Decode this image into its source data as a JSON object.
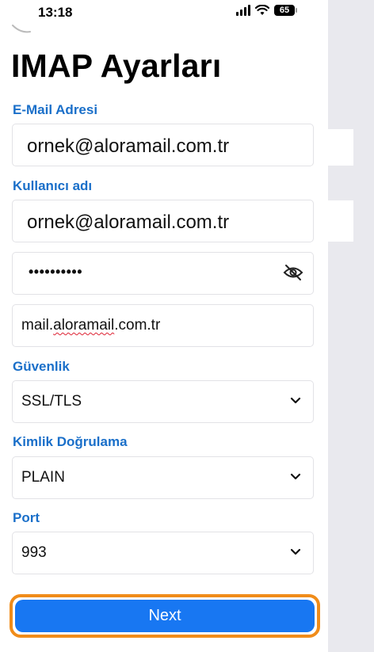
{
  "status_bar": {
    "time": "13:18",
    "battery": "65"
  },
  "page": {
    "title": "IMAP Ayarları"
  },
  "fields": {
    "email_label": "E-Mail Adresi",
    "email_value": "ornek@aloramail.com.tr",
    "username_label": "Kullanıcı adı",
    "username_value": "ornek@aloramail.com.tr",
    "password_masked": "••••••••••",
    "server_value_prefix": "mail.",
    "server_value_domain": "aloramail",
    "server_value_suffix": ".com.tr",
    "security_label": "Güvenlik",
    "security_value": "SSL/TLS",
    "auth_label": "Kimlik Doğrulama",
    "auth_value": "PLAIN",
    "port_label": "Port",
    "port_value": "993"
  },
  "actions": {
    "next_label": "Next"
  },
  "colors": {
    "accent": "#1877f2",
    "label": "#1a6fc9",
    "highlight": "#f08c1a"
  },
  "icons": {
    "back": "chevron-left-icon",
    "password_toggle": "eye-slash-icon",
    "dropdown": "chevron-down-icon",
    "signal": "signal-icon",
    "wifi": "wifi-icon",
    "battery": "battery-icon"
  }
}
